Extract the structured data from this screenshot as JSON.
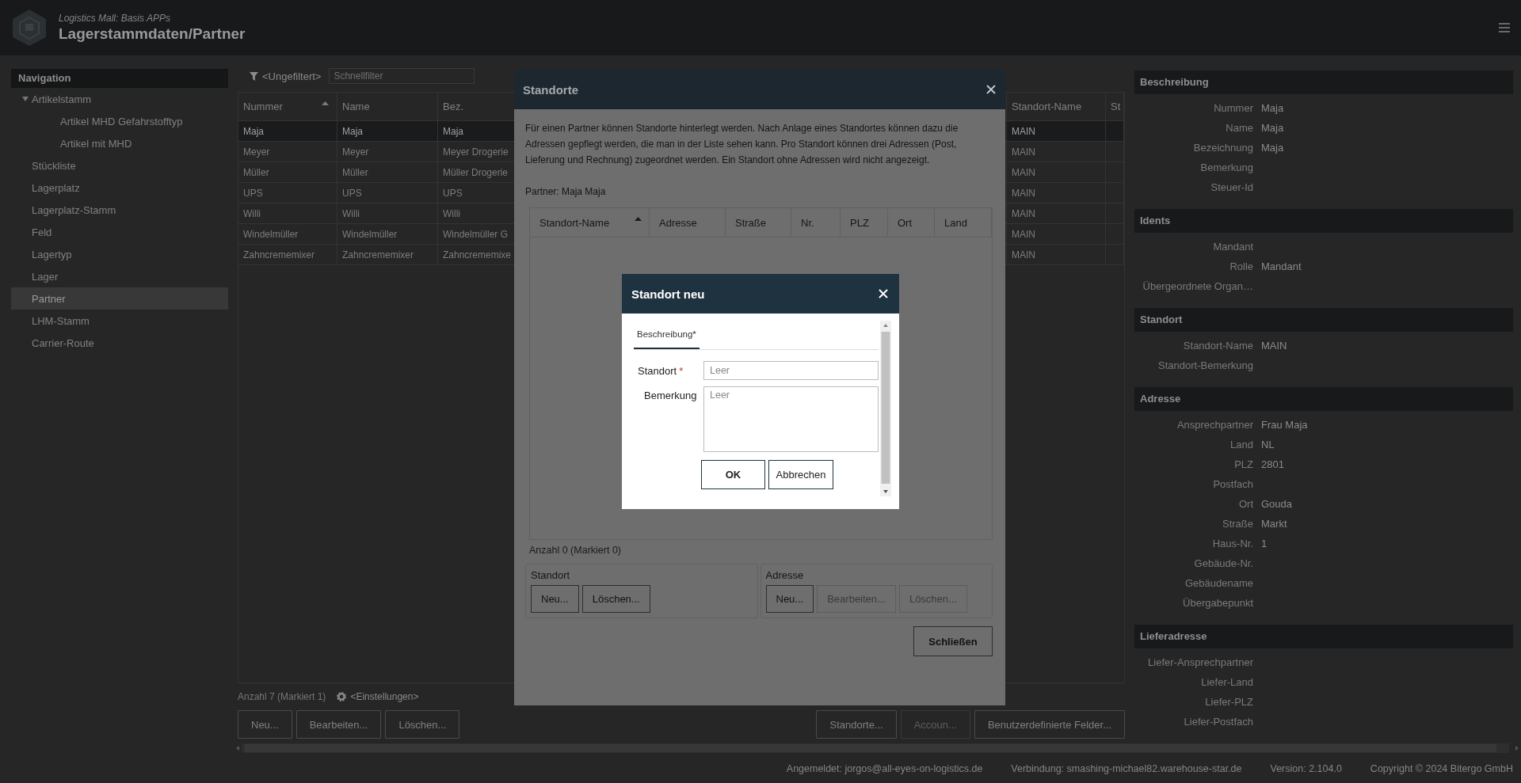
{
  "app": {
    "subtitle": "Logistics Mall: Basis APPs",
    "title": "Lagerstammdaten/Partner"
  },
  "navigation": {
    "title": "Navigation",
    "items": [
      {
        "label": "Artikelstamm",
        "selected": false,
        "expanded": true,
        "children": [
          {
            "label": "Artikel MHD Gefahrstofftyp",
            "selected": false
          },
          {
            "label": "Artikel mit MHD",
            "selected": false
          }
        ]
      },
      {
        "label": "Stückliste",
        "selected": false
      },
      {
        "label": "Lagerplatz",
        "selected": false
      },
      {
        "label": "Lagerplatz-Stamm",
        "selected": false
      },
      {
        "label": "Feld",
        "selected": false
      },
      {
        "label": "Lagertyp",
        "selected": false
      },
      {
        "label": "Lager",
        "selected": false
      },
      {
        "label": "Partner",
        "selected": true
      },
      {
        "label": "LHM-Stamm",
        "selected": false
      },
      {
        "label": "Carrier-Route",
        "selected": false
      }
    ]
  },
  "partner_list": {
    "filter_label": "<Ungefiltert>",
    "quick_filter": {
      "placeholder": "Schnellfilter"
    },
    "columns": [
      {
        "label": "Nummer",
        "sorted": true
      },
      {
        "label": "Name",
        "sorted": false
      },
      {
        "label": "Bez.",
        "sorted": false
      },
      {
        "label": "Standort-Name",
        "sorted": false
      },
      {
        "label": "St",
        "sorted": false
      }
    ],
    "rows": [
      {
        "selected": true,
        "cells": [
          "Maja",
          "Maja",
          "Maja",
          "MAIN",
          ""
        ]
      },
      {
        "selected": false,
        "cells": [
          "Meyer",
          "Meyer",
          "Meyer Drogerie",
          "MAIN",
          ""
        ]
      },
      {
        "selected": false,
        "cells": [
          "Müller",
          "Müller",
          "Müller Drogerie",
          "MAIN",
          ""
        ]
      },
      {
        "selected": false,
        "cells": [
          "UPS",
          "UPS",
          "UPS",
          "MAIN",
          ""
        ]
      },
      {
        "selected": false,
        "cells": [
          "Willi",
          "Willi",
          "Willi",
          "MAIN",
          ""
        ]
      },
      {
        "selected": false,
        "cells": [
          "Windelmüller",
          "Windelmüller",
          "Windelmüller G",
          "MAIN",
          ""
        ]
      },
      {
        "selected": false,
        "cells": [
          "Zahncrememixer",
          "Zahncrememixer",
          "Zahncrememixe",
          "MAIN",
          ""
        ]
      }
    ],
    "count": "Anzahl 7 (Markiert 1)",
    "settings": "<Einstellungen>",
    "buttons": [
      {
        "label": "Neu...",
        "disabled": false
      },
      {
        "label": "Bearbeiten...",
        "disabled": false
      },
      {
        "label": "Löschen...",
        "disabled": false
      }
    ],
    "right_buttons": [
      {
        "label": "Standorte...",
        "disabled": false
      },
      {
        "label": "Accoun...",
        "disabled": true
      },
      {
        "label": "Benutzerdefinierte Felder...",
        "disabled": false
      }
    ]
  },
  "details": {
    "sections": [
      {
        "title": "Beschreibung",
        "fields": [
          {
            "label": "Nummer",
            "value": "Maja"
          },
          {
            "label": "Name",
            "value": "Maja"
          },
          {
            "label": "Bezeichnung",
            "value": "Maja"
          },
          {
            "label": "Bemerkung"
          },
          {
            "label": "Steuer-Id"
          }
        ]
      },
      {
        "title": "Idents",
        "fields": [
          {
            "label": "Mandant"
          },
          {
            "label": "Rolle",
            "value": "Mandant"
          },
          {
            "label": "Übergeordnete Organ…"
          }
        ]
      },
      {
        "title": "Standort",
        "fields": [
          {
            "label": "Standort-Name",
            "value": "MAIN"
          },
          {
            "label": "Standort-Bemerkung"
          }
        ]
      },
      {
        "title": "Adresse",
        "fields": [
          {
            "label": "Ansprechpartner",
            "value": "Frau Maja"
          },
          {
            "label": "Land",
            "value": "NL"
          },
          {
            "label": "PLZ",
            "value": "2801"
          },
          {
            "label": "Postfach"
          },
          {
            "label": "Ort",
            "value": "Gouda"
          },
          {
            "label": "Straße",
            "value": "Markt"
          },
          {
            "label": "Haus-Nr.",
            "value": "1"
          },
          {
            "label": "Gebäude-Nr."
          },
          {
            "label": "Gebäudename"
          },
          {
            "label": "Übergabepunkt"
          }
        ]
      },
      {
        "title": "Lieferadresse",
        "fields": [
          {
            "label": "Liefer-Ansprechpartner"
          },
          {
            "label": "Liefer-Land"
          },
          {
            "label": "Liefer-PLZ"
          },
          {
            "label": "Liefer-Postfach"
          }
        ]
      }
    ]
  },
  "status_bar": [
    "Angemeldet: jorgos@all-eyes-on-logistics.de",
    "Verbindung: smashing-michael82.warehouse-star.de",
    "Version: 2.104.0",
    "Copyright © 2024 Bitergo GmbH"
  ],
  "standorte_dialog": {
    "title": "Standorte",
    "description": "Für einen Partner können Standorte hinterlegt werden. Nach Anlage eines Standortes können dazu die Adressen gepflegt werden, die man in der Liste sehen kann. Pro Standort können drei Adressen (Post, Lieferung und Rechnung) zugeordnet werden. Ein Standort ohne Adressen wird nicht angezeigt.",
    "partner": "Partner: Maja Maja",
    "columns": [
      {
        "label": "Standort-Name",
        "sorted": true
      },
      {
        "label": "Adresse",
        "sorted": false
      },
      {
        "label": "Straße",
        "sorted": false
      },
      {
        "label": "Nr.",
        "sorted": false
      },
      {
        "label": "PLZ",
        "sorted": false
      },
      {
        "label": "Ort",
        "sorted": false
      },
      {
        "label": "Land",
        "sorted": false
      }
    ],
    "count": "Anzahl 0 (Markiert 0)",
    "groups": [
      {
        "title": "Standort",
        "buttons": [
          {
            "label": "Neu...",
            "disabled": false
          },
          {
            "label": "Löschen...",
            "disabled": false
          }
        ]
      },
      {
        "title": "Adresse",
        "buttons": [
          {
            "label": "Neu...",
            "disabled": false
          },
          {
            "label": "Bearbeiten...",
            "disabled": true
          },
          {
            "label": "Löschen...",
            "disabled": true
          }
        ]
      }
    ],
    "close_button": "Schließen"
  },
  "standort_neu_dialog": {
    "title": "Standort neu",
    "tabs": [
      {
        "label": "Beschreibung*",
        "selected": true
      }
    ],
    "fields": [
      {
        "kind": "input",
        "label": "Standort",
        "required_mark": "*",
        "placeholder": "Leer"
      },
      {
        "kind": "textarea",
        "label": "Bemerkung",
        "placeholder": "Leer"
      }
    ],
    "buttons": [
      {
        "label": "OK",
        "kind": "primary"
      },
      {
        "label": "Abbrechen",
        "kind": "secondary"
      }
    ]
  }
}
